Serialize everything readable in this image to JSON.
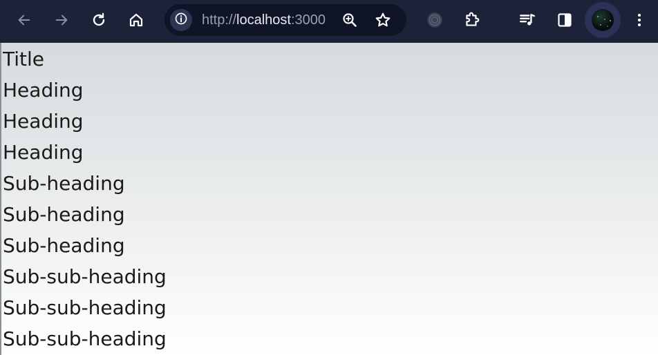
{
  "browser": {
    "url": {
      "scheme": "http://",
      "host": "localhost",
      "port": ":3000"
    },
    "toolbar_color": "#1c2237",
    "icons": {
      "back": "arrow-left-icon",
      "forward": "arrow-right-icon",
      "reload": "reload-icon",
      "home": "home-icon",
      "site_info": "info-icon",
      "zoom": "zoom-in-icon",
      "bookmark": "star-icon",
      "extension_a": "circle-extension-icon",
      "extensions": "puzzle-icon",
      "media": "media-queue-icon",
      "side_panel": "side-panel-icon",
      "menu": "kebab-menu-icon"
    }
  },
  "document": {
    "title": "Title",
    "headings": [
      "Heading",
      "Heading",
      "Heading"
    ],
    "sub_headings": [
      "Sub-heading",
      "Sub-heading",
      "Sub-heading"
    ],
    "sub_sub_headings": [
      "Sub-sub-heading",
      "Sub-sub-heading",
      "Sub-sub-heading"
    ]
  }
}
